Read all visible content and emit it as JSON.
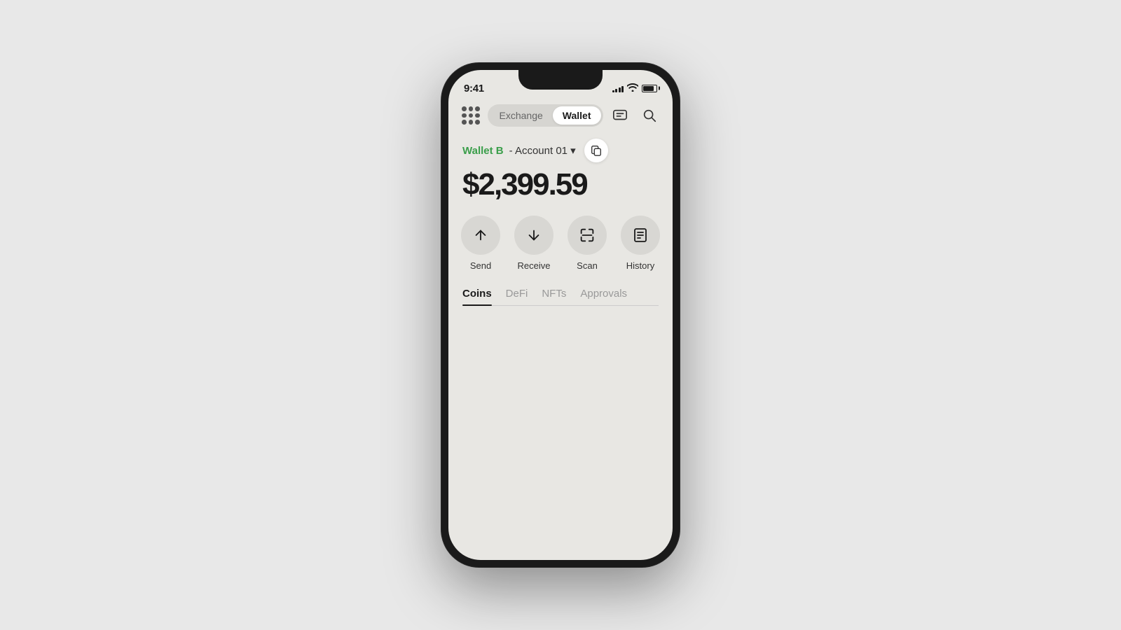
{
  "status": {
    "time": "9:41",
    "signal_bars": [
      3,
      5,
      7,
      9,
      11
    ],
    "wifi": "wifi",
    "battery_level": 85
  },
  "header": {
    "exchange_label": "Exchange",
    "wallet_label": "Wallet",
    "active_tab": "Wallet"
  },
  "account": {
    "name": "Wallet B",
    "separator": " - ",
    "sub": "Account 01",
    "balance": "$2,399.59"
  },
  "actions": [
    {
      "id": "send",
      "label": "Send"
    },
    {
      "id": "receive",
      "label": "Receive"
    },
    {
      "id": "scan",
      "label": "Scan"
    },
    {
      "id": "history",
      "label": "History"
    }
  ],
  "tabs": [
    {
      "id": "coins",
      "label": "Coins",
      "active": true
    },
    {
      "id": "defi",
      "label": "DeFi",
      "active": false
    },
    {
      "id": "nfts",
      "label": "NFTs",
      "active": false
    },
    {
      "id": "approvals",
      "label": "Approvals",
      "active": false
    }
  ]
}
